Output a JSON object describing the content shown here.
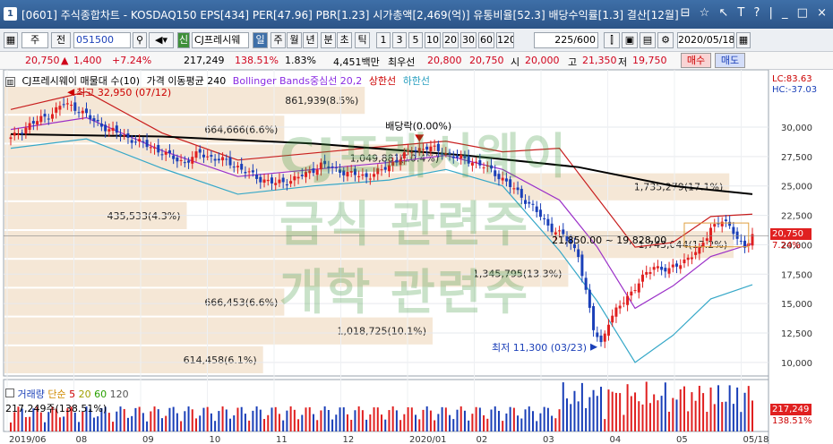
{
  "window": {
    "number": "1",
    "title": "[0601] 주식종합차트 - KOSDAQ150 EPS[434] PER[47.96] PBR[1.23] 시가총액[2,469(억)] 유통비율[52.3] 배당수익률[1.3] 결산[12월]",
    "controls": "⊟ ☆ ↖ T ? | _ □ ×"
  },
  "toolbar": {
    "prefix_box": "주",
    "prefix_btn": "전",
    "code": "051500",
    "stock_badge": "신",
    "stock_name": "CJ프레시웨",
    "periods": [
      "일",
      "주",
      "월",
      "년",
      "분",
      "초",
      "틱"
    ],
    "selected_period": "일",
    "intervals": [
      "1",
      "3",
      "5",
      "10",
      "20",
      "30",
      "60",
      "120"
    ],
    "count": "225/600",
    "date": "2020/05/18"
  },
  "info": {
    "price": "20,750",
    "change_arrow": "▲",
    "change": "1,400",
    "change_pct": "+7.24%",
    "volume": "217,249",
    "volume_ratio": "138.51%",
    "turnover": "1.83%",
    "amount": "4,451백만",
    "best_label": "최우선",
    "best_ask": "20,800",
    "best_bid": "20,750",
    "open_label": "시",
    "open": "20,000",
    "high_label": "고",
    "high": "21,350",
    "low_label": "저",
    "low": "19,750",
    "buy_label": "매수",
    "sell_label": "매도"
  },
  "legend": {
    "title": "CJ프레시웨이 매물대 수(10)",
    "ma": "가격 이동평균 240",
    "bb": "Bollinger Bands중심선 20,2",
    "upper": "상한선",
    "lower": "하한선"
  },
  "annotations": {
    "high": "최고 32,950 (07/12)",
    "low": "최저 11,300 (03/23)",
    "dividend": "배당락(0.00%)",
    "range": "21,850.00 ~ 19,828.00"
  },
  "watermark": [
    "CJ프레시웨이",
    "급식 관련주",
    "개학 관련주"
  ],
  "right_panel": {
    "lc": "LC:83.63",
    "hc": "HC:-37.03",
    "current_price": "20,750",
    "current_pct": "7.24%",
    "vol_value": "217,249",
    "vol_pct": "138.51%"
  },
  "volume_legend": {
    "title": "거래량",
    "ma_label": "단순",
    "p5": "5",
    "p20": "20",
    "p60": "60",
    "p120": "120",
    "value": "217,249주(138.51%)"
  },
  "chart_data": {
    "type": "candlestick",
    "ylim": [
      9000,
      33500
    ],
    "y_ticks": [
      "30,000",
      "27,500",
      "25,000",
      "22,500",
      "20,000",
      "17,500",
      "15,000",
      "12,500",
      "10,000"
    ],
    "x_ticks": [
      "2019/06",
      "08",
      "09",
      "10",
      "11",
      "12",
      "2020/01",
      "02",
      "03",
      "04",
      "05",
      "05/18"
    ],
    "volume_profile": [
      {
        "volume": "861,939",
        "pct": "8.5%"
      },
      {
        "volume": "664,666",
        "pct": "6.6%"
      },
      {
        "volume": "1,049,881",
        "pct": "10.4%"
      },
      {
        "volume": "1,735,279",
        "pct": "17.1%"
      },
      {
        "volume": "435,533",
        "pct": "4.3%"
      },
      {
        "volume": "1,743,044",
        "pct": "17.2%"
      },
      {
        "volume": "1,345,795",
        "pct": "13.3%"
      },
      {
        "volume": "666,453",
        "pct": "6.6%"
      },
      {
        "volume": "1,018,725",
        "pct": "10.1%"
      },
      {
        "volume": "614,458",
        "pct": "6.1%"
      }
    ],
    "price_path": [
      [
        0,
        29000
      ],
      [
        5,
        30200
      ],
      [
        10,
        31000
      ],
      [
        14,
        32000
      ],
      [
        18,
        31500
      ],
      [
        22,
        30500
      ],
      [
        26,
        29800
      ],
      [
        30,
        29200
      ],
      [
        34,
        28700
      ],
      [
        38,
        28200
      ],
      [
        42,
        27500
      ],
      [
        46,
        27000
      ],
      [
        50,
        27800
      ],
      [
        54,
        27300
      ],
      [
        58,
        27000
      ],
      [
        62,
        26200
      ],
      [
        66,
        25600
      ],
      [
        70,
        25200
      ],
      [
        74,
        25500
      ],
      [
        78,
        26000
      ],
      [
        82,
        26800
      ],
      [
        86,
        26400
      ],
      [
        90,
        26000
      ],
      [
        94,
        25800
      ],
      [
        98,
        26300
      ],
      [
        102,
        27200
      ],
      [
        106,
        28000
      ],
      [
        110,
        28300
      ],
      [
        114,
        27900
      ],
      [
        118,
        27400
      ],
      [
        122,
        27100
      ],
      [
        126,
        26500
      ],
      [
        130,
        25600
      ],
      [
        134,
        24400
      ],
      [
        138,
        23200
      ],
      [
        142,
        21600
      ],
      [
        146,
        20800
      ],
      [
        150,
        19200
      ],
      [
        152,
        16000
      ],
      [
        154,
        12800
      ],
      [
        156,
        11600
      ],
      [
        158,
        13500
      ],
      [
        162,
        15200
      ],
      [
        166,
        16800
      ],
      [
        170,
        18200
      ],
      [
        174,
        17800
      ],
      [
        178,
        18700
      ],
      [
        182,
        19500
      ],
      [
        185,
        21500
      ],
      [
        188,
        22000
      ],
      [
        191,
        21200
      ],
      [
        194,
        19700
      ],
      [
        196,
        20750
      ]
    ],
    "ma240": [
      [
        0,
        29400
      ],
      [
        40,
        29200
      ],
      [
        80,
        28600
      ],
      [
        120,
        27600
      ],
      [
        150,
        26600
      ],
      [
        175,
        25000
      ],
      [
        196,
        24300
      ]
    ],
    "bb_upper": [
      [
        0,
        31500
      ],
      [
        20,
        33000
      ],
      [
        40,
        29500
      ],
      [
        60,
        27200
      ],
      [
        80,
        27800
      ],
      [
        100,
        28400
      ],
      [
        115,
        28800
      ],
      [
        130,
        27900
      ],
      [
        145,
        28200
      ],
      [
        155,
        24000
      ],
      [
        165,
        19800
      ],
      [
        175,
        20200
      ],
      [
        185,
        22400
      ],
      [
        196,
        22600
      ]
    ],
    "bb_mid": [
      [
        0,
        29800
      ],
      [
        20,
        30800
      ],
      [
        40,
        28000
      ],
      [
        60,
        25800
      ],
      [
        80,
        26400
      ],
      [
        100,
        27000
      ],
      [
        115,
        27600
      ],
      [
        130,
        26400
      ],
      [
        145,
        23800
      ],
      [
        155,
        19800
      ],
      [
        165,
        14600
      ],
      [
        175,
        16500
      ],
      [
        185,
        19000
      ],
      [
        196,
        20100
      ]
    ],
    "bb_lower": [
      [
        0,
        28200
      ],
      [
        20,
        29000
      ],
      [
        40,
        26500
      ],
      [
        60,
        24300
      ],
      [
        80,
        25000
      ],
      [
        100,
        25500
      ],
      [
        115,
        26400
      ],
      [
        130,
        25000
      ],
      [
        145,
        19500
      ],
      [
        155,
        15200
      ],
      [
        165,
        10000
      ],
      [
        175,
        12300
      ],
      [
        185,
        15400
      ],
      [
        196,
        16600
      ]
    ]
  }
}
